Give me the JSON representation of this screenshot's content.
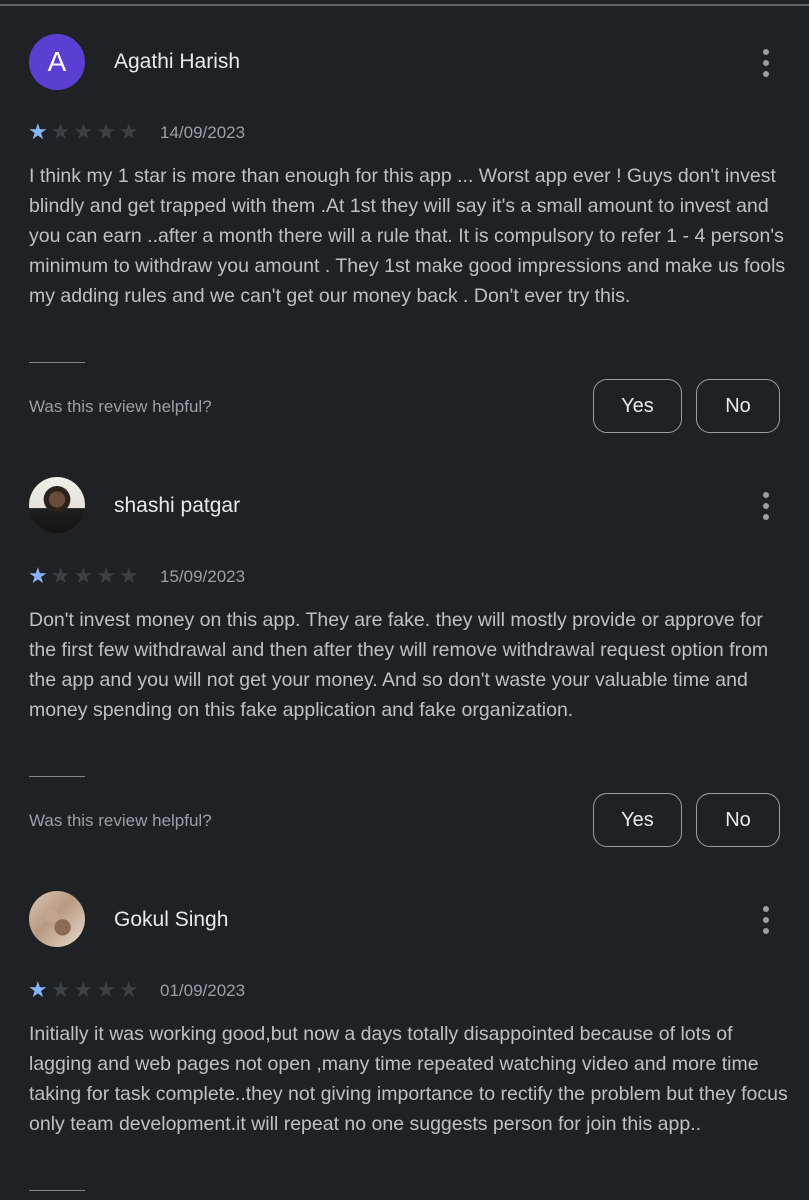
{
  "reviews": [
    {
      "author": "Agathi Harish",
      "avatar_letter": "A",
      "rating": 1,
      "max_rating": 5,
      "date": "14/09/2023",
      "text": "I think my 1 star is more than enough for this app ... Worst app ever ! Guys don't invest blindly and get trapped with them .At 1st they will say it's a small amount to invest and you can earn ..after a month there will a rule that. It is compulsory to refer 1 - 4 person's minimum to withdraw you amount . They 1st make good impressions and make us fools my adding rules and we can't get our money back . Don't ever try this.",
      "helpful_prompt": "Was this review helpful?",
      "yes_label": "Yes",
      "no_label": "No"
    },
    {
      "author": "shashi patgar",
      "rating": 1,
      "max_rating": 5,
      "date": "15/09/2023",
      "text": "Don't invest money on this app. They are fake. they will mostly provide or approve for the first few withdrawal and then after they will remove withdrawal request option from the app and you will not get your money. And so don't waste your valuable time and money spending on this fake application and fake organization.",
      "helpful_prompt": "Was this review helpful?",
      "yes_label": "Yes",
      "no_label": "No"
    },
    {
      "author": "Gokul Singh",
      "rating": 1,
      "max_rating": 5,
      "date": "01/09/2023",
      "text": "Initially it was working good,but now a days totally disappointed because of lots of lagging and web pages not open ,many time repeated watching video and more time taking for task complete..they not giving importance to rectify the problem but they focus only team development.it will repeat no one suggests person for join this app.."
    }
  ],
  "icons": {
    "menu": "more-vert-icon",
    "star": "star-icon"
  },
  "colors": {
    "background": "#202124",
    "star_filled": "#8ab4f8",
    "star_empty": "#3c4043",
    "avatar_letter_bg": "#5b3fd3"
  }
}
